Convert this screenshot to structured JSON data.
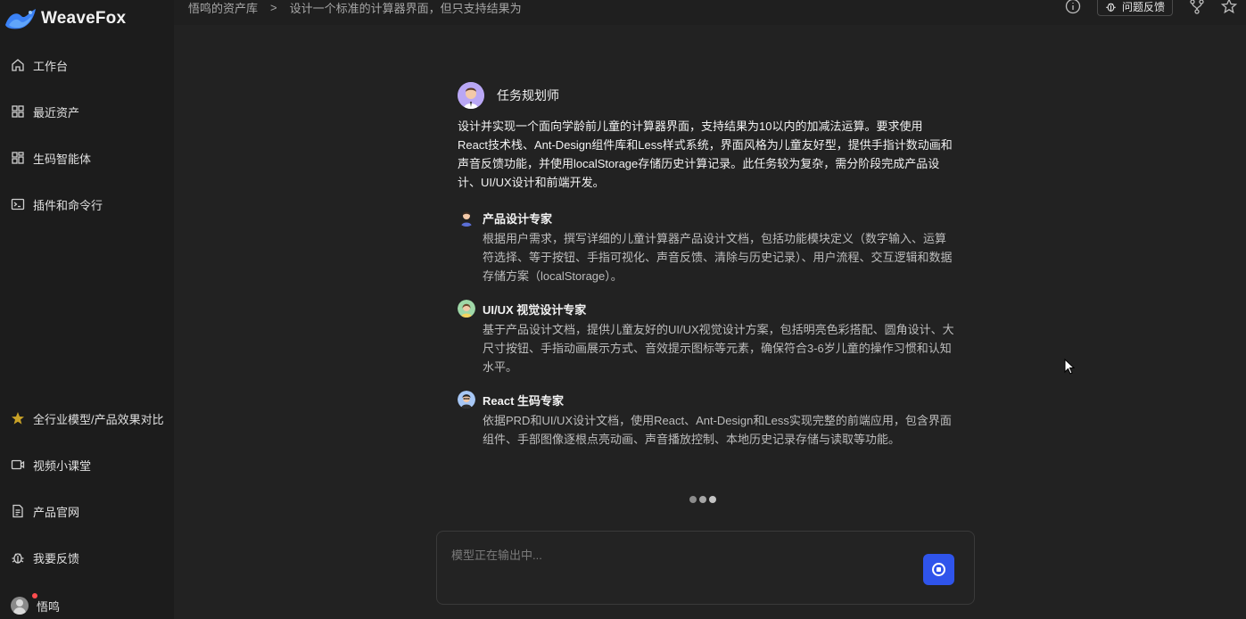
{
  "app": {
    "logo_text": "WeaveFox",
    "logo_icon": "weavefox-logo"
  },
  "sidebar": {
    "top_items": [
      {
        "label": "工作台",
        "icon": "home-icon"
      },
      {
        "label": "最近资产",
        "icon": "grid-icon"
      },
      {
        "label": "生码智能体",
        "icon": "blocks-icon"
      },
      {
        "label": "插件和命令行",
        "icon": "terminal-icon"
      }
    ],
    "bottom_items": [
      {
        "label": "全行业模型/产品效果对比",
        "icon": "star-icon"
      },
      {
        "label": "视频小课堂",
        "icon": "video-icon"
      },
      {
        "label": "产品官网",
        "icon": "document-icon"
      },
      {
        "label": "我要反馈",
        "icon": "bug-icon"
      }
    ],
    "user": {
      "name": "悟鸣",
      "icon": "user-avatar",
      "has_notification": true
    }
  },
  "header": {
    "breadcrumb": [
      "悟鸣的资产库",
      ">",
      "设计一个标准的计算器界面，但只支持结果为"
    ],
    "feedback_label": "问题反馈",
    "icons": [
      "info-icon",
      "bug-icon",
      "branch-icon",
      "star-outline-icon"
    ]
  },
  "planner": {
    "name": "任务规划师",
    "description": "设计并实现一个面向学龄前儿童的计算器界面，支持结果为10以内的加减法运算。要求使用React技术栈、Ant-Design组件库和Less样式系统，界面风格为儿童友好型，提供手指计数动画和声音反馈功能，并使用localStorage存储历史计算记录。此任务较为复杂，需分阶段完成产品设计、UI/UX设计和前端开发。"
  },
  "agents": [
    {
      "name": "产品设计专家",
      "description": "根据用户需求，撰写详细的儿童计算器产品设计文档，包括功能模块定义（数字输入、运算符选择、等于按钮、手指可视化、声音反馈、清除与历史记录）、用户流程、交互逻辑和数据存储方案（localStorage）。"
    },
    {
      "name": "UI/UX 视觉设计专家",
      "description": "基于产品设计文档，提供儿童友好的UI/UX视觉设计方案，包括明亮色彩搭配、圆角设计、大尺寸按钮、手指动画展示方式、音效提示图标等元素，确保符合3-6岁儿童的操作习惯和认知水平。"
    },
    {
      "name": "React 生码专家",
      "description": "依据PRD和UI/UX设计文档，使用React、Ant-Design和Less实现完整的前端应用，包含界面组件、手部图像逐根点亮动画、声音播放控制、本地历史记录存储与读取等功能。"
    }
  ],
  "input": {
    "placeholder": "模型正在输出中...",
    "value": ""
  },
  "colors": {
    "background": "#222222",
    "sidebar": "#1c1c1c",
    "accent": "#2f54eb",
    "notification": "#ff4d4f"
  }
}
